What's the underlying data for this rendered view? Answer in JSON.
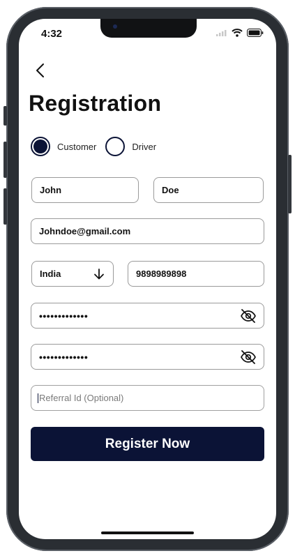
{
  "status_bar": {
    "time": "4:32"
  },
  "header": {
    "title": "Registration"
  },
  "user_type": {
    "options": [
      {
        "label": "Customer",
        "selected": true
      },
      {
        "label": "Driver",
        "selected": false
      }
    ]
  },
  "form": {
    "first_name": "John",
    "last_name": "Doe",
    "email": "Johndoe@gmail.com",
    "country": "India",
    "phone": "9898989898",
    "password_mask": "•••••••••••••",
    "confirm_password_mask": "•••••••••••••",
    "referral_placeholder": "Referral Id (Optional)"
  },
  "actions": {
    "register_label": "Register Now"
  },
  "colors": {
    "primary": "#0b1336",
    "border": "#9a9a9a",
    "text": "#111111"
  }
}
